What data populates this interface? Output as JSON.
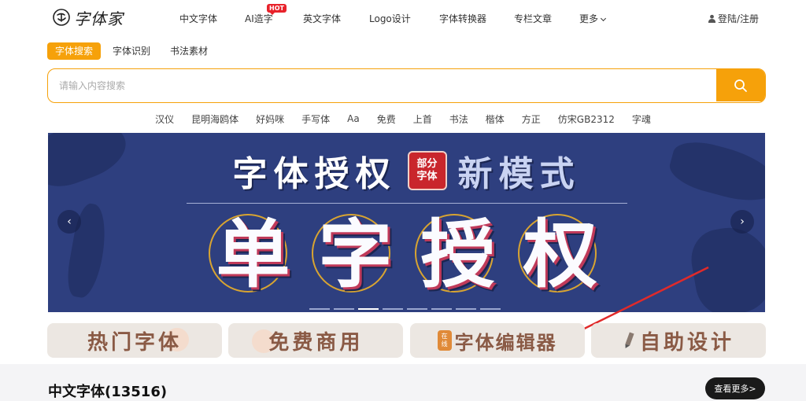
{
  "header": {
    "logo_text": "字体家",
    "nav": [
      {
        "label": "中文字体"
      },
      {
        "label": "AI造字",
        "badge": "HOT"
      },
      {
        "label": "英文字体"
      },
      {
        "label": "Logo设计"
      },
      {
        "label": "字体转换器"
      },
      {
        "label": "专栏文章"
      },
      {
        "label": "更多"
      }
    ],
    "login_label": "登陆/注册"
  },
  "search": {
    "tabs": [
      {
        "label": "字体搜索",
        "active": true
      },
      {
        "label": "字体识别",
        "active": false
      },
      {
        "label": "书法素材",
        "active": false
      }
    ],
    "placeholder": "请输入内容搜索",
    "value": ""
  },
  "keywords": [
    "汉仪",
    "昆明海鸥体",
    "好妈咪",
    "手写体",
    "Aa",
    "免费",
    "上首",
    "书法",
    "楷体",
    "方正",
    "仿宋GB2312",
    "字魂"
  ],
  "banner": {
    "title_left": "字体授权",
    "seal_line1": "部分",
    "seal_line2": "字体",
    "title_right": "新模式",
    "big_chars": [
      "单",
      "字",
      "授",
      "权"
    ],
    "prev_label": "‹",
    "next_label": "›",
    "slide_count": 8,
    "active_slide": 2
  },
  "cards": [
    {
      "label": "热门字体"
    },
    {
      "label": "免费商用"
    },
    {
      "label": "字体编辑器",
      "badge_line1": "在",
      "badge_line2": "线"
    },
    {
      "label": "自助设计"
    }
  ],
  "section": {
    "title": "中文字体(13516)",
    "more_label": "查看更多>"
  },
  "colors": {
    "accent": "#f6a10a",
    "banner_bg": "#2e3f7f",
    "hot_badge": "#e8222b",
    "card_bg": "#ece7e2",
    "annotation_arrow": "#e02a2a"
  }
}
